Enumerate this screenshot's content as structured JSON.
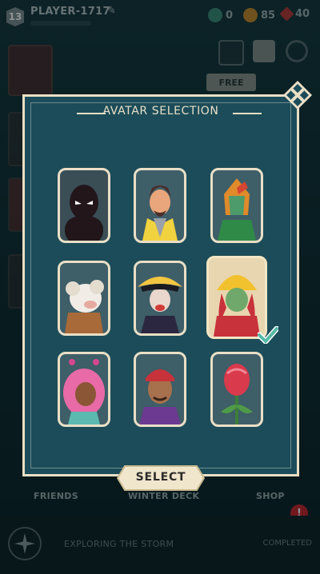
{
  "player": {
    "level": "13",
    "name": "PLAYER-1717"
  },
  "currency": {
    "gems": "0",
    "coins": "85",
    "tokens": "40"
  },
  "header": {
    "free_label": "FREE"
  },
  "modal": {
    "title": "AVATAR SELECTION",
    "select_label": "SELECT"
  },
  "avatars": [
    {
      "name": "shadow"
    },
    {
      "name": "wizard"
    },
    {
      "name": "serpent-knight"
    },
    {
      "name": "ram"
    },
    {
      "name": "pirate-captain"
    },
    {
      "name": "sun-priestess",
      "selected": true
    },
    {
      "name": "pink-hair-girl"
    },
    {
      "name": "bandana-pirate"
    },
    {
      "name": "rose"
    }
  ],
  "nav": {
    "friends": "FRIENDS",
    "deck": "WINTER DECK",
    "shop": "SHOP"
  },
  "quest": {
    "title": "EXPLORING THE STORM",
    "status": "COMPLETED"
  },
  "colors": {
    "panel": "#1c4c59",
    "border": "#e9dfc6",
    "check": "#56b9a5"
  }
}
